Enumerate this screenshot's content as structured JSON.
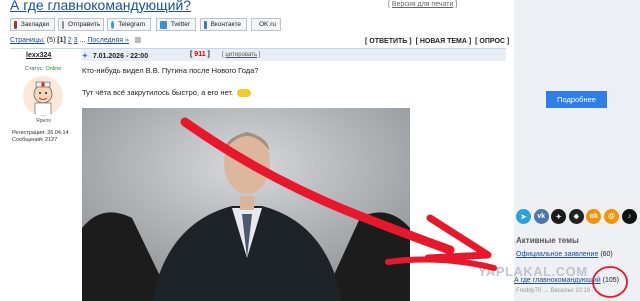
{
  "header": {
    "title": "А где главнокомандующий?",
    "print_link": "Версия для печати",
    "print_bracket_open": "[",
    "print_bracket_close": "]"
  },
  "share": [
    {
      "label": "Закладки",
      "icon": "bookmark-icon",
      "color": "#b0342c"
    },
    {
      "label": "Отправить",
      "icon": "mail-icon",
      "color": "#8a8f97"
    },
    {
      "label": "Telegram",
      "icon": "telegram-icon",
      "color": "#29a0da"
    },
    {
      "label": "Twitter",
      "icon": "twitter-icon",
      "color": "#3b8fd6"
    },
    {
      "label": "Вконтакте",
      "icon": "vk-icon",
      "color": "#4a76a8"
    },
    {
      "label": "OK.ru",
      "icon": "ok-icon",
      "color": "#f2940a"
    }
  ],
  "pager": {
    "label": "Страницы:",
    "total": "(5)",
    "current": "[1]",
    "p2": "2",
    "p3": "3",
    "ellipsis": "...",
    "last": "Последняя »"
  },
  "topic_actions": {
    "reply": "[ ОТВЕТИТЬ ]",
    "new_topic": "[ НОВАЯ ТЕМА ]",
    "poll": "[ ОПРОС ]"
  },
  "post": {
    "author": "lexx324",
    "status_label": "Статус:",
    "status_value": "Online",
    "avatar_caption": "Яриля",
    "reg_label": "Регистрация:",
    "reg_date": "26.04.14",
    "msgs_label": "Сообщений:",
    "msgs_count": "2127",
    "date": "7.01.2026 - 22:00",
    "rating_open": "[",
    "rating": "911",
    "rating_close": "]",
    "quote_open": "[",
    "quote": "цитировать",
    "quote_close": "]",
    "p1": "Кто-нибудь видел В.В. Путина после Нового Года?",
    "p2": "Тут чёта всё закрутилось быстро, а его нет."
  },
  "sidebar": {
    "ad_button": "Подробнее",
    "social": [
      {
        "icon": "telegram-icon",
        "color": "#2aa3da",
        "glyph": "➤"
      },
      {
        "icon": "vk-icon",
        "color": "#4a76a8",
        "glyph": "vk"
      },
      {
        "icon": "star-icon",
        "color": "#1a1a1a",
        "glyph": "✦"
      },
      {
        "icon": "dzen-icon",
        "color": "#222222",
        "glyph": "✸"
      },
      {
        "icon": "ok-icon",
        "color": "#f2940a",
        "glyph": "ok"
      },
      {
        "icon": "mail-ru-icon",
        "color": "#f2940a",
        "glyph": "@"
      },
      {
        "icon": "tiktok-icon",
        "color": "#111111",
        "glyph": "♪"
      }
    ],
    "active_title": "Активные темы",
    "topic1_title": "Официальное заявление",
    "topic1_count": "(60)",
    "topic2_title": "А где главнокомандующий",
    "topic2_count": "(105)",
    "topic2_author": "Freddy70",
    "topic2_sep": "→",
    "topic2_prev": "Весельч",
    "topic2_time": "10:19"
  },
  "watermark": "YAPLAKAL.COM",
  "colors": {
    "link": "#1a4f9c",
    "accent": "#2f7ee8",
    "rating": "#cc0000",
    "annotation": "#e8182c"
  }
}
